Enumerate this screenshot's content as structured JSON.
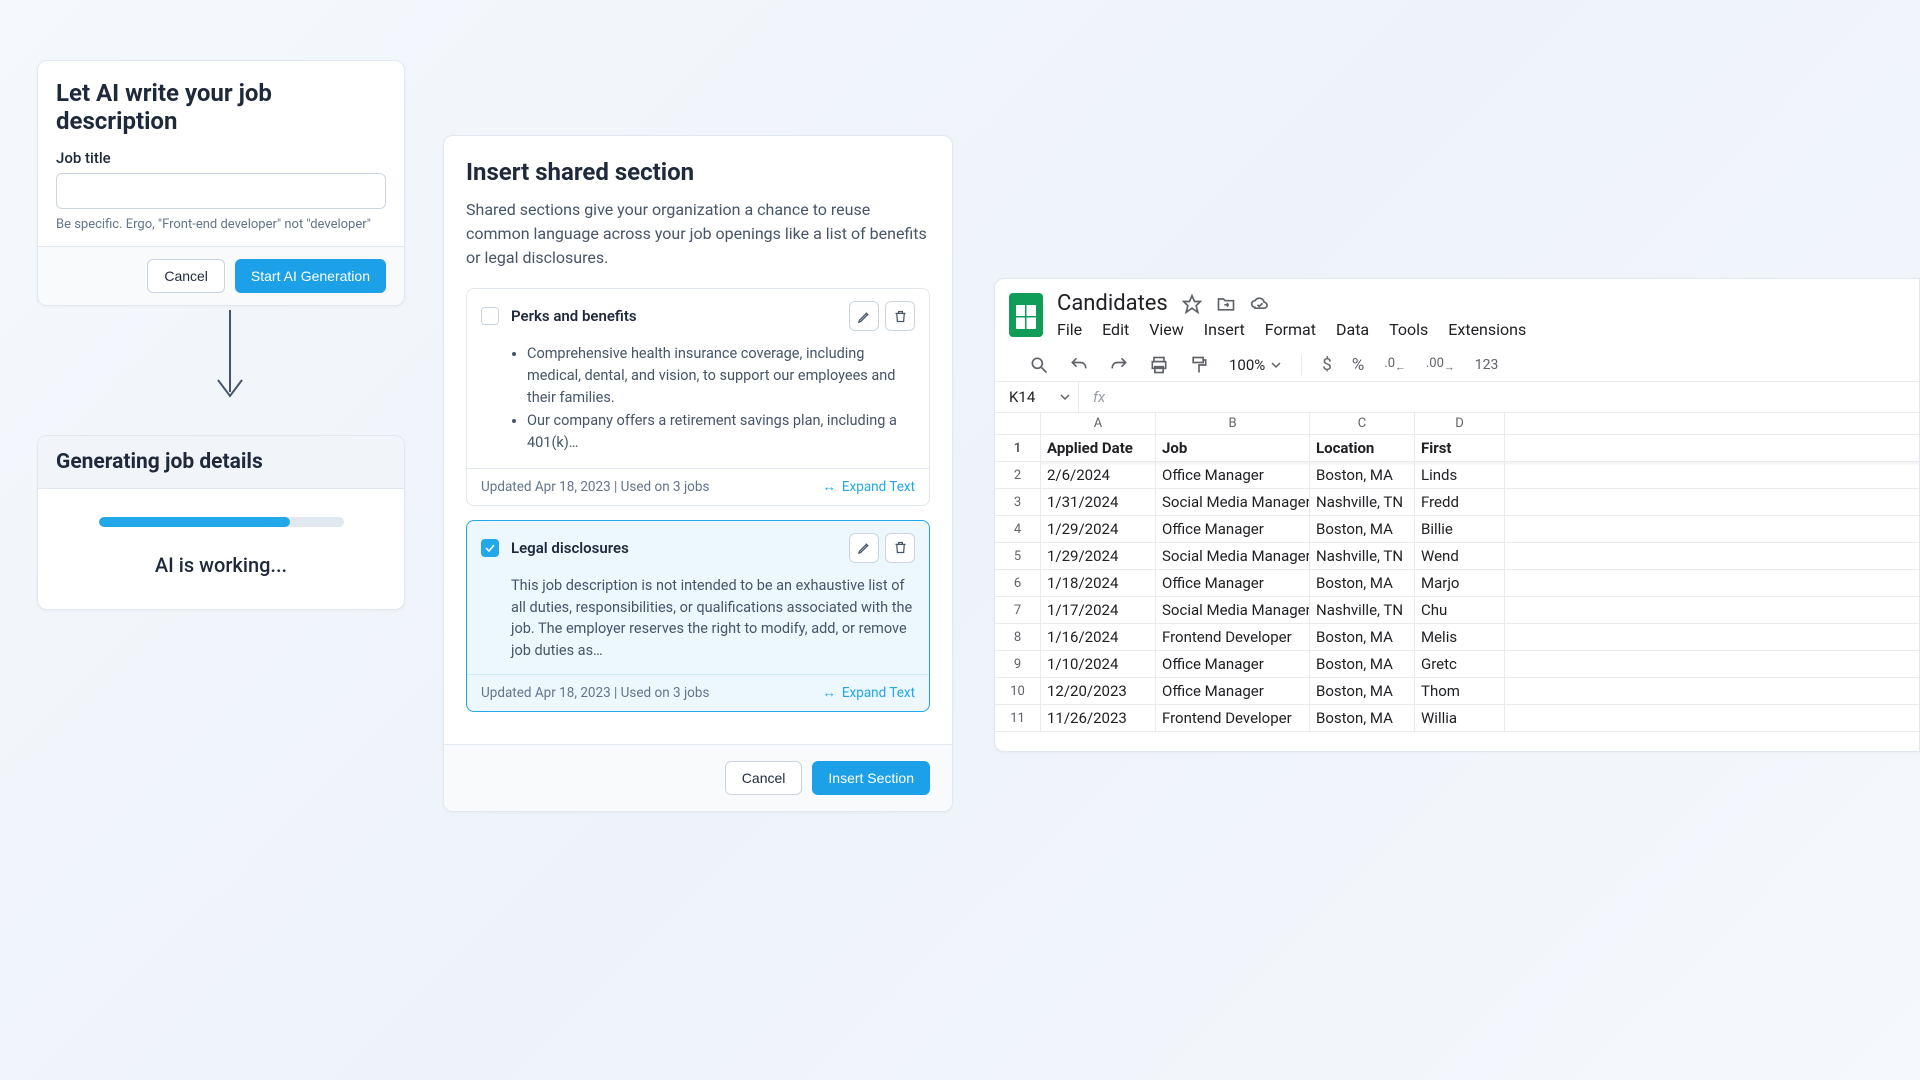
{
  "card1": {
    "title": "Let AI write your job description",
    "job_title_label": "Job title",
    "job_title_value": "",
    "hint": "Be specific. Ergo, \"Front-end developer\" not \"developer\"",
    "cancel": "Cancel",
    "start": "Start AI Generation"
  },
  "card2": {
    "title": "Generating job details",
    "progress_pct": 78,
    "status": "AI is working..."
  },
  "card3": {
    "title": "Insert shared section",
    "desc": "Shared sections give your organization a chance to reuse common language across your job openings like a list of benefits or legal disclosures.",
    "sections": [
      {
        "name": "Perks and benefits",
        "checked": false,
        "bullets": [
          "Comprehensive health insurance coverage, including medical, dental, and vision, to support our employees and their families.",
          "Our company offers a retirement savings plan, including a 401(k)…"
        ],
        "meta": "Updated Apr 18, 2023 | Used on 3 jobs",
        "expand": "Expand Text"
      },
      {
        "name": "Legal disclosures",
        "checked": true,
        "body": "This job description is not intended to be an exhaustive list of all duties, responsibilities, or qualifications associated with the job. The employer reserves the right to modify, add, or remove job duties as…",
        "meta": "Updated Apr 18, 2023 | Used on 3 jobs",
        "expand": "Expand Text"
      }
    ],
    "cancel": "Cancel",
    "insert": "Insert Section"
  },
  "sheets": {
    "docname": "Candidates",
    "menus": [
      "File",
      "Edit",
      "View",
      "Insert",
      "Format",
      "Data",
      "Tools",
      "Extensions"
    ],
    "zoom": "100%",
    "namebox": "K14",
    "columns": [
      "A",
      "B",
      "C",
      "D"
    ],
    "header_row": [
      "Applied Date",
      "Job",
      "Location",
      "First"
    ],
    "rows": [
      [
        "2/6/2024",
        "Office Manager",
        "Boston, MA",
        "Linds"
      ],
      [
        "1/31/2024",
        "Social Media Manager",
        "Nashville, TN",
        "Fredd"
      ],
      [
        "1/29/2024",
        "Office Manager",
        "Boston, MA",
        "Billie"
      ],
      [
        "1/29/2024",
        "Social Media Manager",
        "Nashville, TN",
        "Wend"
      ],
      [
        "1/18/2024",
        "Office Manager",
        "Boston, MA",
        "Marjo"
      ],
      [
        "1/17/2024",
        "Social Media Manager",
        "Nashville, TN",
        "Chu"
      ],
      [
        "1/16/2024",
        "Frontend Developer",
        "Boston, MA",
        "Melis"
      ],
      [
        "1/10/2024",
        "Office Manager",
        "Boston, MA",
        "Gretc"
      ],
      [
        "12/20/2023",
        "Office Manager",
        "Boston, MA",
        "Thom"
      ],
      [
        "11/26/2023",
        "Frontend Developer",
        "Boston, MA",
        "Willia"
      ]
    ]
  }
}
